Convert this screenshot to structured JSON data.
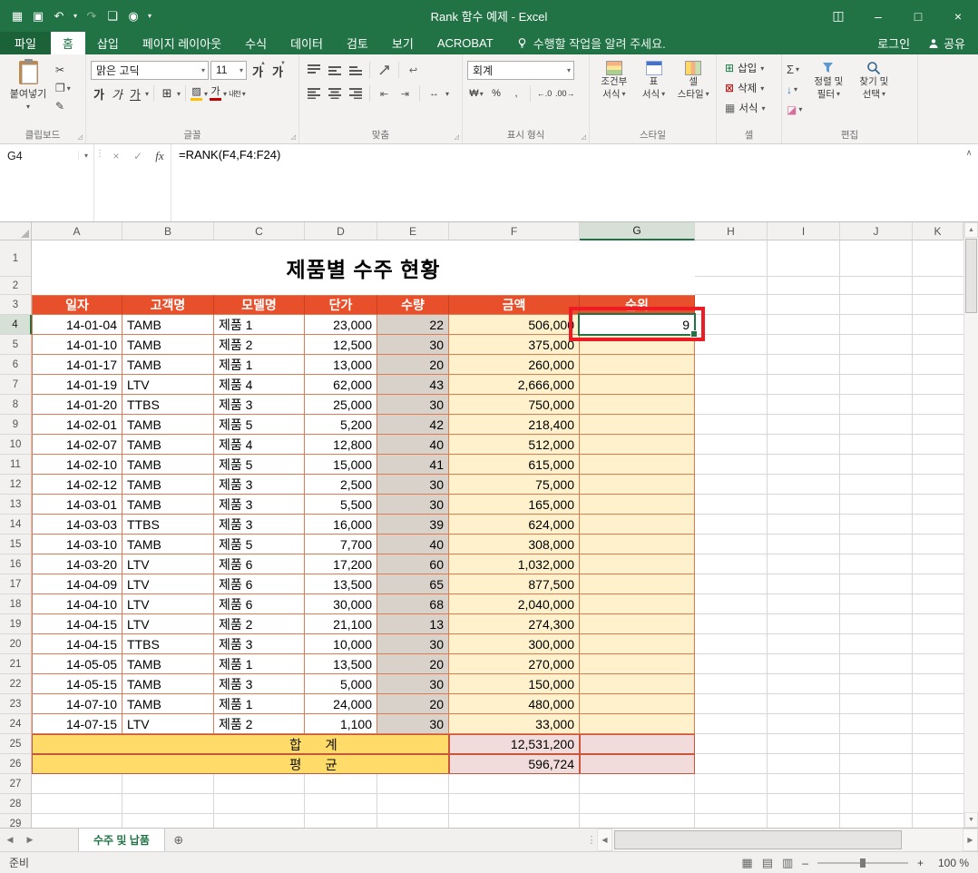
{
  "window": {
    "title": "Rank 함수 예제 - Excel"
  },
  "icons": {
    "app": "▦",
    "save": "▣",
    "undo": "↶",
    "redo": "↷",
    "new_doc": "❏",
    "camera": "◉",
    "dropdown": "▾",
    "up_chev": "∧",
    "windows": "◫",
    "minimize": "–",
    "maximize": "□",
    "close": "×",
    "scissors": "✂",
    "copy": "❐",
    "painter": "✎",
    "ga": "가",
    "phonetic": "내천",
    "borders": "⊞",
    "fill": "▨",
    "currency": "₩",
    "percent": "%",
    "comma": ",",
    "inc_dec": "←.0",
    "dec_dec": ".00→",
    "sigma": "Σ",
    "fill_down": "↓",
    "eraser": "◪",
    "insert_cells": "⊞",
    "delete_cells": "⊠",
    "format_cells": "▦",
    "sash": "⋮",
    "cancel": "×",
    "enter": "✓",
    "fx": "fx",
    "prev": "◀",
    "next": "▶",
    "up": "▲",
    "down": "▼",
    "add_sheet": "⊕",
    "splitter": "⋮",
    "view_normal": "▦",
    "view_layout": "▤",
    "view_break": "▥",
    "zoom_out": "–",
    "zoom_in": "+",
    "grow_font_mark": "▲",
    "shrink_font_mark": "▼",
    "launcher": "◿",
    "wrap": "↩",
    "merge_arrows": "↔",
    "indent_dec": "⇤",
    "indent_inc": "⇥"
  },
  "ribbon": {
    "file": "파일",
    "tabs": [
      "홈",
      "삽입",
      "페이지 레이아웃",
      "수식",
      "데이터",
      "검토",
      "보기",
      "ACROBAT"
    ],
    "tell_me": "수행할 작업을 알려 주세요.",
    "login": "로그인",
    "share": "공유",
    "clipboard": {
      "label": "클립보드",
      "paste": "붙여넣기"
    },
    "font": {
      "label": "글꼴",
      "name": "맑은 고딕",
      "size": "11"
    },
    "align": {
      "label": "맞춤"
    },
    "number": {
      "label": "표시 형식",
      "format": "회계"
    },
    "styles": {
      "label": "스타일",
      "cond1": "조건부",
      "cond2": "서식",
      "table1": "표",
      "table2": "서식",
      "cell1": "셀",
      "cell2": "스타일"
    },
    "cells": {
      "label": "셀",
      "insert": "삽입",
      "delete": "삭제",
      "format": "서식"
    },
    "edit": {
      "label": "편집",
      "sort1": "정렬 및",
      "sort2": "필터",
      "find1": "찾기 및",
      "find2": "선택"
    }
  },
  "formula_bar": {
    "name_box": "G4",
    "formula": "=RANK(F4,F4:F24)"
  },
  "sheet": {
    "columns": [
      "A",
      "B",
      "C",
      "D",
      "E",
      "F",
      "G",
      "H",
      "I",
      "J",
      "K"
    ],
    "selected": {
      "cell": "G4",
      "col": "G",
      "row": 4
    },
    "title": "제품별 수주 현황",
    "headers": [
      "일자",
      "고객명",
      "모델명",
      "단가",
      "수량",
      "금액",
      "순위"
    ],
    "rows": [
      [
        "14-01-04",
        "TAMB",
        "제품 1",
        "23,000",
        "22",
        "506,000",
        "9"
      ],
      [
        "14-01-10",
        "TAMB",
        "제품 2",
        "12,500",
        "30",
        "375,000",
        ""
      ],
      [
        "14-01-17",
        "TAMB",
        "제품 1",
        "13,000",
        "20",
        "260,000",
        ""
      ],
      [
        "14-01-19",
        "LTV",
        "제품 4",
        "62,000",
        "43",
        "2,666,000",
        ""
      ],
      [
        "14-01-20",
        "TTBS",
        "제품 3",
        "25,000",
        "30",
        "750,000",
        ""
      ],
      [
        "14-02-01",
        "TAMB",
        "제품 5",
        "5,200",
        "42",
        "218,400",
        ""
      ],
      [
        "14-02-07",
        "TAMB",
        "제품 4",
        "12,800",
        "40",
        "512,000",
        ""
      ],
      [
        "14-02-10",
        "TAMB",
        "제품 5",
        "15,000",
        "41",
        "615,000",
        ""
      ],
      [
        "14-02-12",
        "TAMB",
        "제품 3",
        "2,500",
        "30",
        "75,000",
        ""
      ],
      [
        "14-03-01",
        "TAMB",
        "제품 3",
        "5,500",
        "30",
        "165,000",
        ""
      ],
      [
        "14-03-03",
        "TTBS",
        "제품 3",
        "16,000",
        "39",
        "624,000",
        ""
      ],
      [
        "14-03-10",
        "TAMB",
        "제품 5",
        "7,700",
        "40",
        "308,000",
        ""
      ],
      [
        "14-03-20",
        "LTV",
        "제품 6",
        "17,200",
        "60",
        "1,032,000",
        ""
      ],
      [
        "14-04-09",
        "LTV",
        "제품 6",
        "13,500",
        "65",
        "877,500",
        ""
      ],
      [
        "14-04-10",
        "LTV",
        "제품 6",
        "30,000",
        "68",
        "2,040,000",
        ""
      ],
      [
        "14-04-15",
        "LTV",
        "제품 2",
        "21,100",
        "13",
        "274,300",
        ""
      ],
      [
        "14-04-15",
        "TTBS",
        "제품 3",
        "10,000",
        "30",
        "300,000",
        ""
      ],
      [
        "14-05-05",
        "TAMB",
        "제품 1",
        "13,500",
        "20",
        "270,000",
        ""
      ],
      [
        "14-05-15",
        "TAMB",
        "제품 3",
        "5,000",
        "30",
        "150,000",
        ""
      ],
      [
        "14-07-10",
        "TAMB",
        "제품 1",
        "24,000",
        "20",
        "480,000",
        ""
      ],
      [
        "14-07-15",
        "LTV",
        "제품 2",
        "1,100",
        "30",
        "33,000",
        ""
      ]
    ],
    "sum_row": {
      "left": "합",
      "right": "계",
      "value": "12,531,200"
    },
    "avg_row": {
      "left": "평",
      "right": "균",
      "value": "596,724"
    }
  },
  "sheet_tabs": {
    "active": "수주 및 납품"
  },
  "status_bar": {
    "ready": "준비",
    "zoom": "100 %"
  },
  "colors": {
    "titlebar_green": "#217346",
    "selection_green": "#217346",
    "table_header_bg": "#E8502B",
    "table_border": "#DF7B52",
    "total_border": "#C7563B",
    "qty_col_bg": "#D8D2CB",
    "amount_col_bg": "#FFF1CB",
    "total_label_bg": "#FFDB69",
    "total_value_bg": "#F1DCDB",
    "annotation_red": "#ED1C24",
    "fill_color_swatch": "#FFC000",
    "font_color_swatch": "#C00000"
  }
}
